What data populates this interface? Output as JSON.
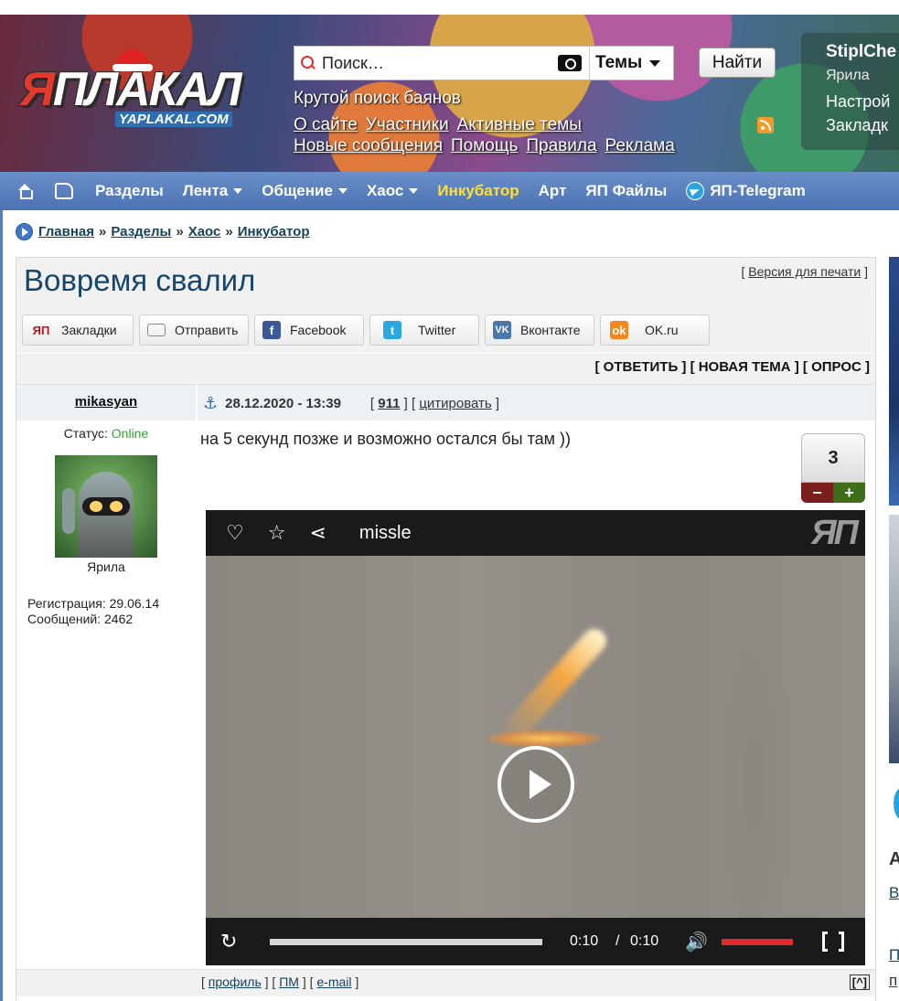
{
  "header": {
    "logo_text": "ЯПЛАКАЛ",
    "logo_sub": "YAPLAKAL.COM",
    "search_placeholder": "Поиск…",
    "topics_select": "Темы",
    "find_button": "Найти",
    "tagline": "Крутой поиск баянов",
    "links_row1": [
      "О сайте",
      "Участники",
      "Активные темы"
    ],
    "links_row2": [
      "Новые сообщения",
      "Помощь",
      "Правила",
      "Реклама"
    ],
    "user": {
      "name": "StiplChe",
      "rank": "Ярила",
      "settings": "Настрой",
      "bookmarks": "Закладк"
    }
  },
  "nav": {
    "items": [
      "Разделы",
      "Лента",
      "Общение",
      "Хаос",
      "Инкубатор",
      "Арт",
      "ЯП Файлы",
      "ЯП-Telegram"
    ]
  },
  "breadcrumb": [
    "Главная",
    "Разделы",
    "Хаос",
    "Инкубатор"
  ],
  "topic": {
    "title": "Вовремя свалил",
    "print_version": "Версия для печати",
    "share_buttons": [
      {
        "label": "Закладки",
        "icon": "yap-icon",
        "color": "#c0141b"
      },
      {
        "label": "Отправить",
        "icon": "envelope-icon",
        "color": "#888888"
      },
      {
        "label": "Facebook",
        "icon": "facebook-icon",
        "color": "#3b5998"
      },
      {
        "label": "Twitter",
        "icon": "twitter-icon",
        "color": "#2aa9e0"
      },
      {
        "label": "Вконтакте",
        "icon": "vk-icon",
        "color": "#4a76a8"
      },
      {
        "label": "OK.ru",
        "icon": "ok-icon",
        "color": "#f2891f"
      }
    ],
    "actions": "[ ОТВЕТИТЬ ] [ НОВАЯ ТЕМА ] [ ОПРОС ]"
  },
  "post": {
    "author": "mikasyan",
    "date": "28.12.2020 - 13:39",
    "number": "911",
    "quote_link": "цитировать",
    "status_label": "Статус: ",
    "status_value": "Online",
    "avatar_caption": "Ярила",
    "registration": "Регистрация: 29.06.14",
    "messages": "Сообщений: 2462",
    "text": "на 5 секунд позже и возможно остался бы там ))",
    "rating": "3",
    "rating_minus": "−",
    "rating_plus": "+",
    "footer_links": [
      "профиль",
      "ПМ",
      "e-mail"
    ],
    "to_top": "[^]"
  },
  "video": {
    "title": "missle",
    "logo": "ЯП",
    "time_current": "0:10",
    "time_sep": "/",
    "time_total": "0:10",
    "progress": 1.0
  },
  "sidebar": {
    "letter": "А",
    "link1": "В",
    "link2": "П",
    "link3": "п"
  }
}
